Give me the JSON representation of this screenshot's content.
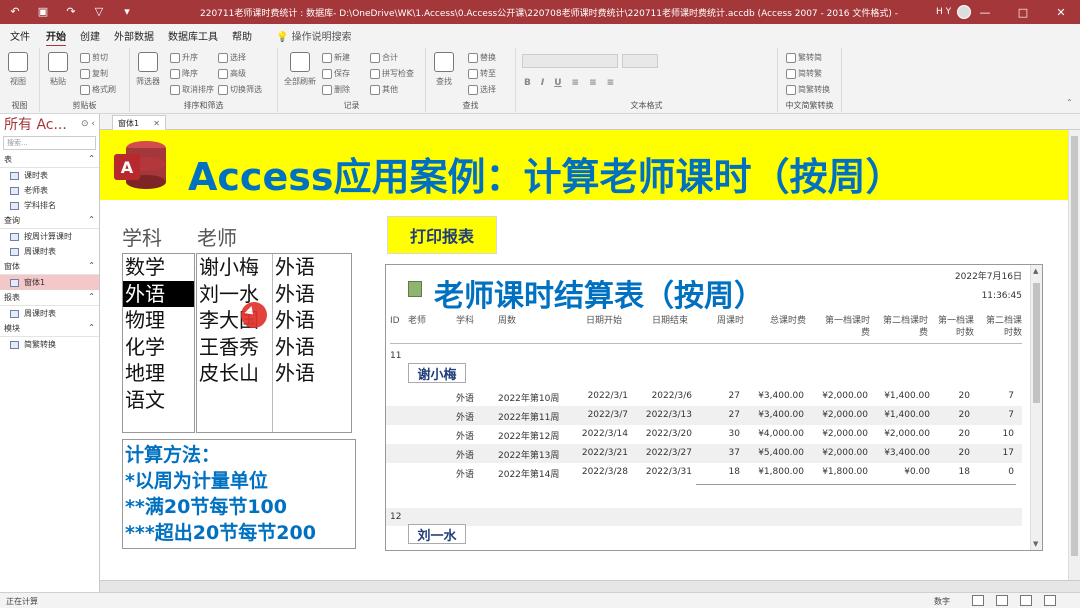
{
  "window": {
    "title": "220711老师课时费统计 : 数据库- D:\\OneDrive\\WK\\1.Access\\0.Access公开课\\220708老师课时费统计\\220711老师课时费统计.accdb (Access 2007 - 2016 文件格式) - Access",
    "user": "H Y",
    "min_symbol": "—",
    "max_symbol": "□",
    "close_symbol": "✕"
  },
  "menu": [
    "文件",
    "开始",
    "创建",
    "外部数据",
    "数据库工具",
    "帮助"
  ],
  "tell_me": "操作说明搜索",
  "ribbon": {
    "groups": [
      "视图",
      "剪贴板",
      "排序和筛选",
      "记录",
      "查找",
      "文本格式",
      "中文简繁转换"
    ],
    "view": "视图",
    "paste": "粘贴",
    "cut": "剪切",
    "copy": "复制",
    "format_painter": "格式刷",
    "filter": "筛选器",
    "ascending": "升序",
    "descending": "降序",
    "remove_sort": "取消排序",
    "selection": "选择",
    "advanced": "高级",
    "toggle_filter": "切换筛选",
    "refresh_all": "全部刷新",
    "new": "新建",
    "save": "保存",
    "delete": "删除",
    "totals": "合计",
    "spelling": "拼写检查",
    "more": "其他",
    "find": "查找",
    "replace": "替换",
    "goto": "转至",
    "select": "选择",
    "to_traditional": "繁转简",
    "to_simplified": "简转繁",
    "convert": "简繁转换"
  },
  "nav": {
    "title": "所有 Ac...",
    "search_placeholder": "搜索...",
    "categories": [
      {
        "name": "表",
        "items": [
          {
            "label": "课时表"
          },
          {
            "label": "老师表"
          },
          {
            "label": "学科排名"
          }
        ]
      },
      {
        "name": "查询",
        "items": [
          {
            "label": "按周计算课时"
          },
          {
            "label": "周课时表"
          }
        ]
      },
      {
        "name": "窗体",
        "items": [
          {
            "label": "窗体1"
          }
        ]
      },
      {
        "name": "报表",
        "items": [
          {
            "label": "周课时表"
          }
        ]
      },
      {
        "name": "模块",
        "items": [
          {
            "label": "简繁转换"
          }
        ]
      }
    ]
  },
  "doc_tab": {
    "label": "窗体1",
    "close": "✕"
  },
  "form": {
    "banner_title": "Access应用案例：计算老师课时（按周）",
    "subject_label": "学科",
    "teacher_label": "老师",
    "subjects": [
      {
        "name": "数学"
      },
      {
        "name": "外语"
      },
      {
        "name": "物理"
      },
      {
        "name": "化学"
      },
      {
        "name": "地理"
      },
      {
        "name": "语文"
      }
    ],
    "teachers": [
      {
        "name": "谢小梅",
        "subject": "外语"
      },
      {
        "name": "刘一水",
        "subject": "外语"
      },
      {
        "name": "李大国",
        "subject": "外语"
      },
      {
        "name": "王香秀",
        "subject": "外语"
      },
      {
        "name": "皮长山",
        "subject": "外语"
      }
    ],
    "method": {
      "title": "计算方法：",
      "line1": "*以周为计量单位",
      "line2": "**满20节每节100",
      "line3": "***超出20节每节200"
    },
    "print_button": "打印报表"
  },
  "report": {
    "title": "老师课时结算表（按周）",
    "date": "2022年7月16日",
    "time": "11:36:45",
    "columns": [
      "ID",
      "老师",
      "学科",
      "周数",
      "日期开始",
      "日期结束",
      "周课时",
      "总课时费",
      "第一档课时费",
      "第二档课时费",
      "第一档课时数",
      "第二档课时数"
    ],
    "groups": [
      {
        "id": "11",
        "teacher": "谢小梅",
        "rows": [
          {
            "subject": "外语",
            "week": "2022年第10周",
            "start": "2022/3/1",
            "end": "2022/3/6",
            "hours": "27",
            "total": "¥3,400.00",
            "fee1": "¥2,000.00",
            "fee2": "¥1,400.00",
            "n1": "20",
            "n2": "7"
          },
          {
            "subject": "外语",
            "week": "2022年第11周",
            "start": "2022/3/7",
            "end": "2022/3/13",
            "hours": "27",
            "total": "¥3,400.00",
            "fee1": "¥2,000.00",
            "fee2": "¥1,400.00",
            "n1": "20",
            "n2": "7"
          },
          {
            "subject": "外语",
            "week": "2022年第12周",
            "start": "2022/3/14",
            "end": "2022/3/20",
            "hours": "30",
            "total": "¥4,000.00",
            "fee1": "¥2,000.00",
            "fee2": "¥2,000.00",
            "n1": "20",
            "n2": "10"
          },
          {
            "subject": "外语",
            "week": "2022年第13周",
            "start": "2022/3/21",
            "end": "2022/3/27",
            "hours": "37",
            "total": "¥5,400.00",
            "fee1": "¥2,000.00",
            "fee2": "¥3,400.00",
            "n1": "20",
            "n2": "17"
          },
          {
            "subject": "外语",
            "week": "2022年第14周",
            "start": "2022/3/28",
            "end": "2022/3/31",
            "hours": "18",
            "total": "¥1,800.00",
            "fee1": "¥1,800.00",
            "fee2": "¥0.00",
            "n1": "18",
            "n2": "0"
          }
        ]
      },
      {
        "id": "12",
        "teacher": "刘一水",
        "rows": []
      }
    ]
  },
  "status": {
    "text": "正在计算",
    "numlock": "数字"
  },
  "colors": {
    "accent": "#a4373a",
    "banner": "#ffff00",
    "title_blue": "#0070c0"
  }
}
